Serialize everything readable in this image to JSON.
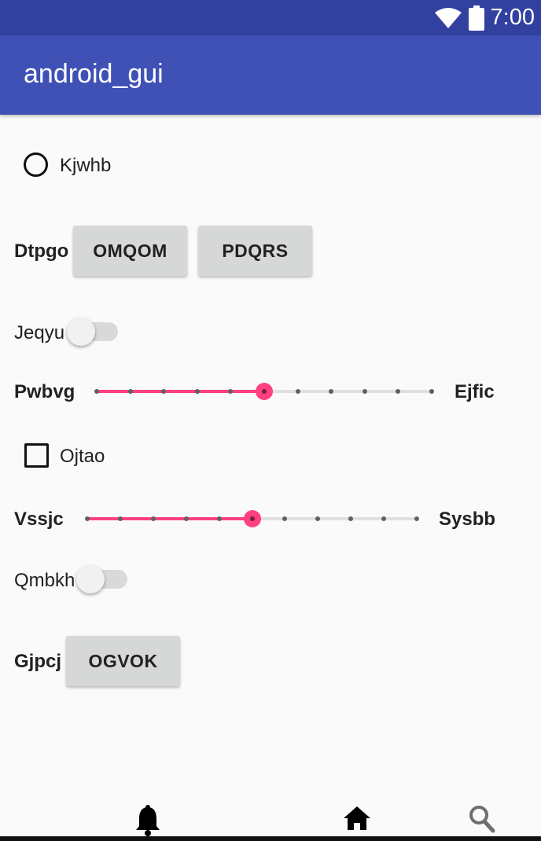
{
  "status_bar": {
    "time": "7:00",
    "icons": [
      "wifi-icon",
      "battery-icon"
    ]
  },
  "app_bar": {
    "title": "android_gui"
  },
  "radio": {
    "label": "Kjwhb",
    "checked": false
  },
  "button_row": {
    "label": "Dtpgo",
    "buttons": [
      "OMQOM",
      "PDQRS"
    ]
  },
  "switch1": {
    "label": "Jeqyu",
    "on": false
  },
  "slider1": {
    "label_left": "Pwbvg",
    "label_right": "Ejfic",
    "value": 5,
    "max": 10
  },
  "checkbox": {
    "label": "Ojtao",
    "checked": false
  },
  "slider2": {
    "label_left": "Vssjc",
    "label_right": "Sysbb",
    "value": 5,
    "max": 10
  },
  "switch2": {
    "label": "Qmbkh",
    "on": false
  },
  "button_row2": {
    "label": "Gjpcj",
    "button": "OGVOK"
  },
  "bottom_nav": {
    "icons": [
      "bell-icon",
      "home-icon",
      "search-icon"
    ]
  },
  "colors": {
    "status_bar": "#3241a0",
    "app_bar": "#3f51b5",
    "accent": "#ff4081",
    "button": "#d6d7d7"
  }
}
